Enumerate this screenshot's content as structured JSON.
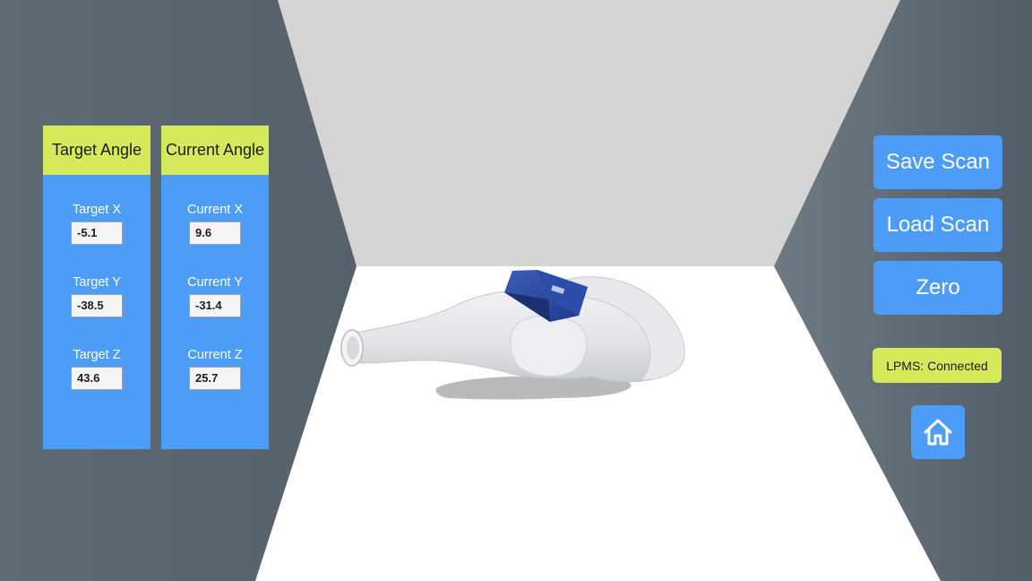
{
  "target_panel": {
    "header": "Target Angle",
    "fields": [
      {
        "label": "Target X",
        "value": "-5.1"
      },
      {
        "label": "Target Y",
        "value": "-38.5"
      },
      {
        "label": "Target Z",
        "value": "43.6"
      }
    ]
  },
  "current_panel": {
    "header": "Current Angle",
    "fields": [
      {
        "label": "Current X",
        "value": "9.6"
      },
      {
        "label": "Current Y",
        "value": "-31.4"
      },
      {
        "label": "Current Z",
        "value": "25.7"
      }
    ]
  },
  "actions": {
    "save_label": "Save Scan",
    "load_label": "Load Scan",
    "zero_label": "Zero"
  },
  "status": {
    "text": "LPMS: Connected"
  },
  "icons": {
    "home": "home-icon"
  },
  "colors": {
    "panel_blue": "#4d9cf8",
    "header_yellow": "#d5e95a",
    "wall_gray": "#5b6670",
    "floor_white": "#ffffff",
    "back_wall": "#d4d4d2"
  }
}
